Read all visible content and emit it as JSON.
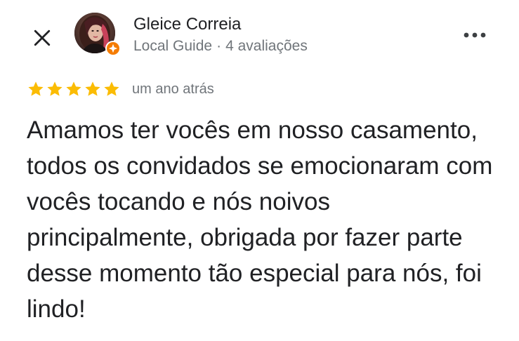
{
  "reviewer": {
    "name": "Gleice Correia",
    "badge": "Local Guide",
    "separator": "·",
    "reviews_count": "4 avaliações",
    "avatar_icon": "profile-photo",
    "badge_icon": "local-guide-badge-icon"
  },
  "review": {
    "rating": 5,
    "max_rating": 5,
    "date": "um ano atrás",
    "text": "Amamos ter vocês em nosso casamento, todos os convidados se emocionaram com vocês tocando e nós noivos principalmente, obrigada por fazer parte desse momento tão especial para nós, foi lindo!"
  },
  "controls": {
    "close_icon": "close-icon",
    "more_icon": "more-options-icon"
  },
  "colors": {
    "star": "#fbbc04",
    "badge": "#f57c00",
    "text": "#202124",
    "secondary": "#70757a"
  }
}
